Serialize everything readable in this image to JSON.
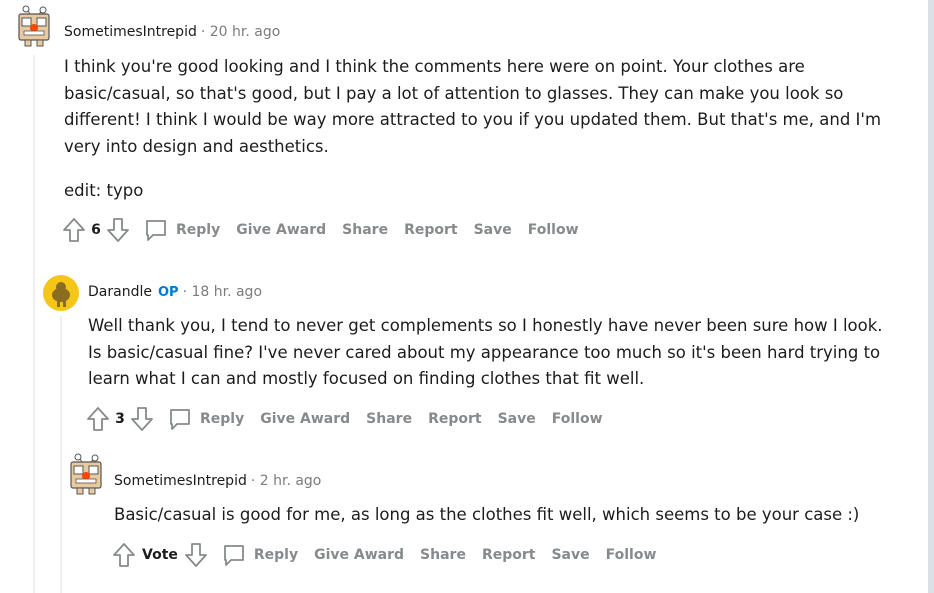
{
  "comments": [
    {
      "author": "SometimesIntrepid",
      "op_badge": "",
      "time": "· 20 hr. ago",
      "paragraphs": [
        "I think you're good looking and I think the comments here were on point. Your clothes are basic/casual, so that's good, but I pay a lot of attention to glasses. They can make you look so different! I think I would be way more attracted to you if you updated them. But that's me, and I'm very into design and aesthetics.",
        "edit: typo"
      ],
      "score": "6",
      "actions": {
        "reply": "Reply",
        "give_award": "Give Award",
        "share": "Share",
        "report": "Report",
        "save": "Save",
        "follow": "Follow"
      }
    },
    {
      "author": "Darandle",
      "op_badge": "OP",
      "time": "· 18 hr. ago",
      "paragraphs": [
        "Well thank you, I tend to never get complements so I honestly have never been sure how I look. Is basic/casual fine? I've never cared about my appearance too much so it's been hard trying to learn what I can and mostly focused on finding clothes that fit well."
      ],
      "score": "3",
      "actions": {
        "reply": "Reply",
        "give_award": "Give Award",
        "share": "Share",
        "report": "Report",
        "save": "Save",
        "follow": "Follow"
      }
    },
    {
      "author": "SometimesIntrepid",
      "op_badge": "",
      "time": "· 2 hr. ago",
      "paragraphs": [
        "Basic/casual is good for me, as long as the clothes fit well, which seems to be your case :)"
      ],
      "score": "Vote",
      "actions": {
        "reply": "Reply",
        "give_award": "Give Award",
        "share": "Share",
        "report": "Report",
        "save": "Save",
        "follow": "Follow"
      }
    }
  ],
  "colors": {
    "text": "#1c1c1c",
    "muted": "#7c7c7c",
    "action": "#878a8c",
    "op_blue": "#0079d3",
    "thread_line": "#edeff1",
    "avatar_yellow": "#f5c518"
  },
  "icons": {
    "robot_avatar": "snoo-robot-icon",
    "yellow_avatar": "snoo-yellow-icon",
    "upvote": "upvote-arrow-icon",
    "downvote": "downvote-arrow-icon",
    "reply": "speech-bubble-icon"
  }
}
